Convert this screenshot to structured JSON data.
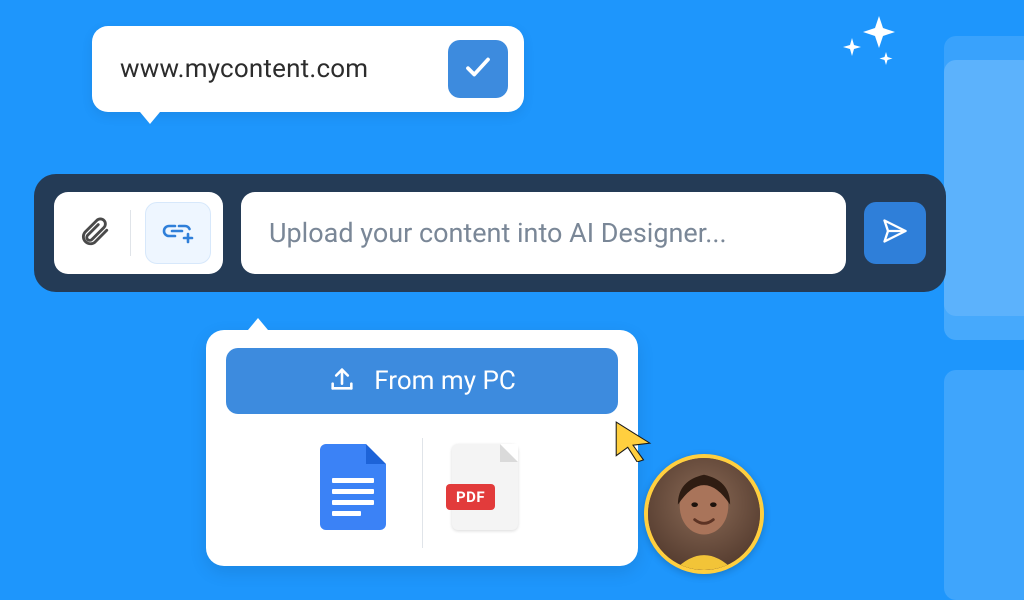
{
  "url_bubble": {
    "url": "www.mycontent.com"
  },
  "main_bar": {
    "placeholder": "Upload your content into AI Designer..."
  },
  "upload_popover": {
    "from_pc_label": "From my PC",
    "pdf_badge": "PDF"
  }
}
